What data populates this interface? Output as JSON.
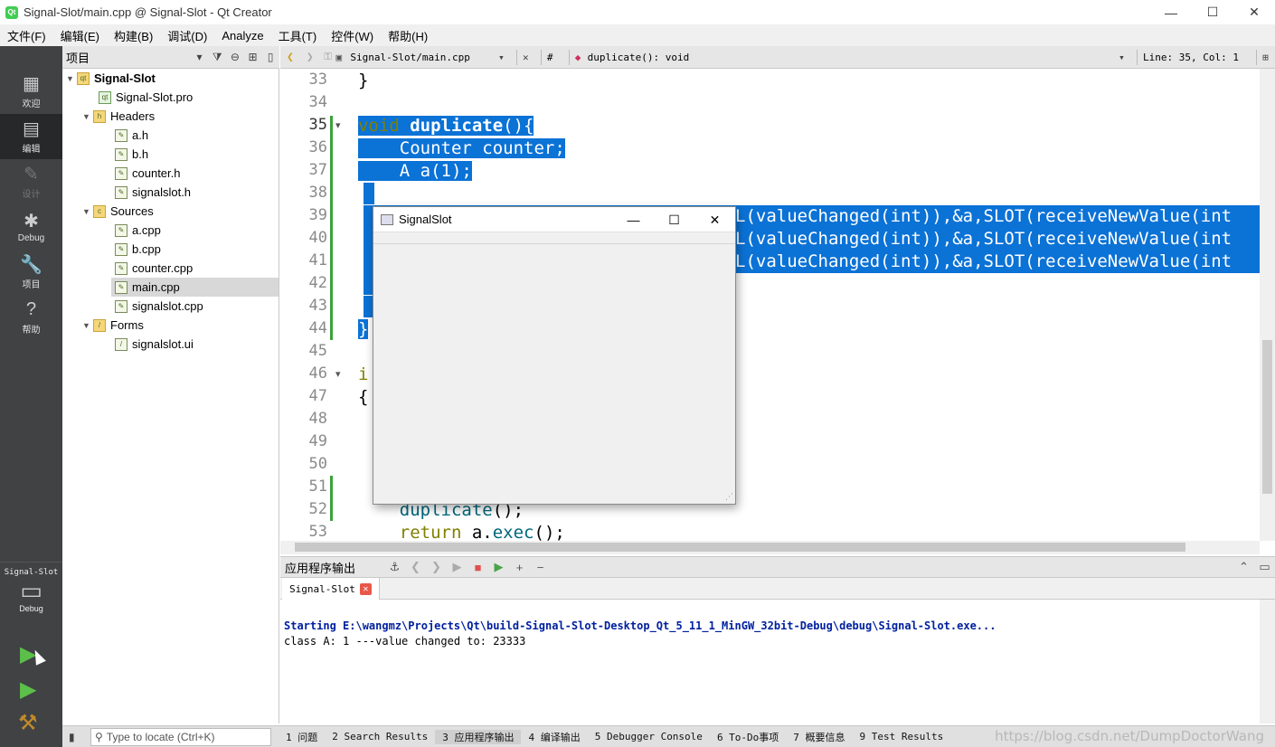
{
  "window": {
    "title": "Signal-Slot/main.cpp @ Signal-Slot - Qt Creator",
    "app_icon": "qt-logo-icon",
    "min_glyph": "—",
    "max_glyph": "☐",
    "close_glyph": "✕"
  },
  "menu": [
    "文件(F)",
    "编辑(E)",
    "构建(B)",
    "调试(D)",
    "Analyze",
    "工具(T)",
    "控件(W)",
    "帮助(H)"
  ],
  "modes": [
    {
      "label": "欢迎",
      "icon": "grid-icon",
      "glyph": "▦"
    },
    {
      "label": "编辑",
      "icon": "edit-doc-icon",
      "glyph": "▤"
    },
    {
      "label": "设计",
      "icon": "pencil-icon",
      "glyph": "✎"
    },
    {
      "label": "Debug",
      "icon": "bug-icon",
      "glyph": "✱"
    },
    {
      "label": "项目",
      "icon": "wrench-icon",
      "glyph": "🔧"
    },
    {
      "label": "帮助",
      "icon": "help-icon",
      "glyph": "?"
    }
  ],
  "kit": {
    "project": "Signal-Slot",
    "mode": "Debug",
    "monitor_glyph": "▭"
  },
  "run_glyphs": {
    "run": "▶",
    "debug_run": "▶",
    "build": "⚒"
  },
  "project_pane": {
    "selector": "项目",
    "tree": [
      {
        "label": "Signal-Slot",
        "kind": "project",
        "bold": true
      },
      {
        "label": "Signal-Slot.pro",
        "kind": "pro"
      },
      {
        "label": "Headers",
        "kind": "folder"
      },
      {
        "label": "a.h",
        "kind": "file"
      },
      {
        "label": "b.h",
        "kind": "file"
      },
      {
        "label": "counter.h",
        "kind": "file"
      },
      {
        "label": "signalslot.h",
        "kind": "file"
      },
      {
        "label": "Sources",
        "kind": "folder"
      },
      {
        "label": "a.cpp",
        "kind": "file"
      },
      {
        "label": "b.cpp",
        "kind": "file"
      },
      {
        "label": "counter.cpp",
        "kind": "file"
      },
      {
        "label": "main.cpp",
        "kind": "file",
        "selected": true
      },
      {
        "label": "signalslot.cpp",
        "kind": "file"
      },
      {
        "label": "Forms",
        "kind": "folder"
      },
      {
        "label": "signalslot.ui",
        "kind": "file"
      }
    ]
  },
  "editor_toolbar": {
    "file": "Signal-Slot/main.cpp",
    "hash": "#",
    "symbol": "duplicate(): void",
    "position": "Line: 35, Col: 1"
  },
  "editor": {
    "line_numbers": [
      "33",
      "34",
      "35",
      "36",
      "37",
      "38",
      "39",
      "40",
      "41",
      "42",
      "43",
      "44",
      "45",
      "46",
      "47",
      "48",
      "49",
      "50",
      "51",
      "52",
      "53"
    ],
    "code": {
      "l33": "}",
      "l35_kw": "void ",
      "l35_fn": "duplicate",
      "l35_rest": "(){",
      "l36": "    Counter counter;",
      "l37": "    A a(1);",
      "l39": "L(valueChanged(int)),&a,SLOT(receiveNewValue(int",
      "l40": "L(valueChanged(int)),&a,SLOT(receiveNewValue(int",
      "l41": "L(valueChanged(int)),&a,SLOT(receiveNewValue(int",
      "l44": "}",
      "l46": "i",
      "l47": "{",
      "l52_pre": "    ",
      "l52_fn": "duplicate",
      "l52_post": "();",
      "l53_pre": "    ",
      "l53_kw": "return",
      "l53_mid": " a.",
      "l53_fn": "exec",
      "l53_post": "();"
    }
  },
  "popup": {
    "title": "SignalSlot",
    "min": "—",
    "max": "☐",
    "close": "✕"
  },
  "output": {
    "pane_title": "应用程序输出",
    "tab": "Signal-Slot",
    "line1": "Starting E:\\wangmz\\Projects\\Qt\\build-Signal-Slot-Desktop_Qt_5_11_1_MinGW_32bit-Debug\\debug\\Signal-Slot.exe...",
    "line2": "class A: 1 ---value changed to: 23333"
  },
  "statusbar": {
    "locate_placeholder": "Type to locate (Ctrl+K)",
    "tabs": [
      "1 问题",
      "2 Search Results",
      "3 应用程序输出",
      "4 编译输出",
      "5 Debugger Console",
      "6 To-Do事项",
      "7 概要信息",
      "9 Test Results"
    ],
    "watermark": "https://blog.csdn.net/DumpDoctorWang"
  },
  "colors": {
    "selection": "#0b72d6",
    "modebar": "#404244",
    "keyword": "#808000",
    "function": "#00677c"
  }
}
